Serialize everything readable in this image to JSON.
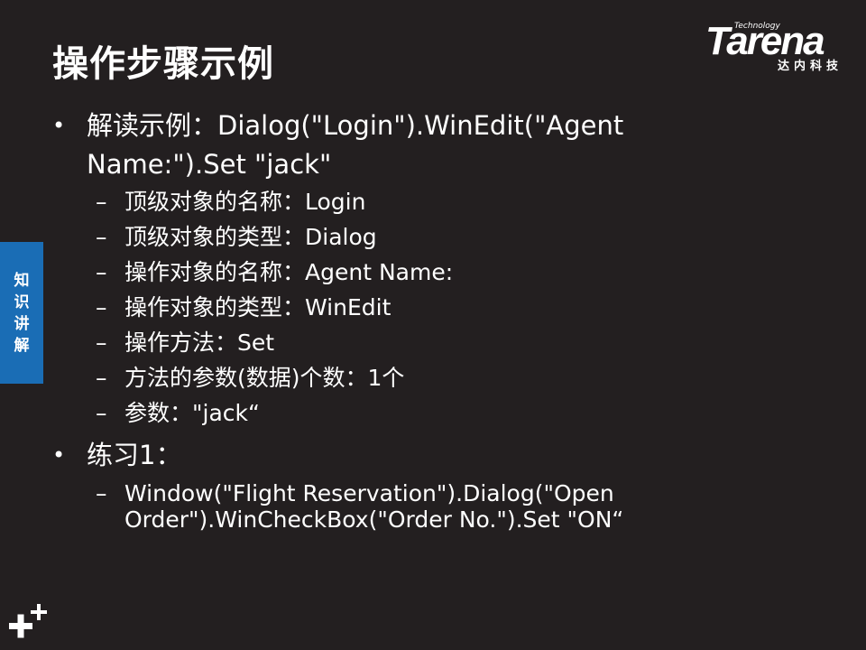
{
  "slide": {
    "title": "操作步骤示例"
  },
  "logo": {
    "tagline": "Technology",
    "brand": "Tarena",
    "subtitle": "达内科技"
  },
  "side_tab": {
    "chars": [
      "知",
      "识",
      "讲",
      "解"
    ]
  },
  "bullets": {
    "b1_line1": "解读示例：Dialog(\"Login\").WinEdit(\"Agent",
    "b1_line2": "Name:\").Set \"jack\"",
    "sub1": [
      "顶级对象的名称：Login",
      "顶级对象的类型：Dialog",
      "操作对象的名称：Agent Name:",
      "操作对象的类型：WinEdit",
      "操作方法：Set",
      "方法的参数(数据)个数：1个",
      "参数：\"jack“"
    ],
    "b2": "练习1：",
    "sub2_line1": "Window(\"Flight Reservation\").Dialog(\"Open",
    "sub2_line2": "Order\").WinCheckBox(\"Order No.\").Set \"ON“"
  }
}
